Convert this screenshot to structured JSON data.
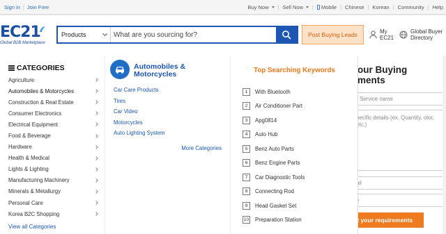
{
  "topbar": {
    "sign_in": "Sign in",
    "join_free": "Join Free",
    "links": [
      {
        "label": "Buy Now",
        "dropdown": true
      },
      {
        "label": "Sell Now",
        "dropdown": true
      },
      {
        "label": "Mobile",
        "icon": "mobile-icon"
      },
      {
        "label": "Chinese"
      },
      {
        "label": "Korean"
      },
      {
        "label": "Community"
      },
      {
        "label": "Help"
      }
    ]
  },
  "header": {
    "logo_text": "EC21",
    "logo_tagline": "Global B2B Marketplace",
    "search": {
      "category": "Products",
      "placeholder": "What are you sourcing for?"
    },
    "post_buying_leads": "Post Buying Leads",
    "my_ec21_line1": "My",
    "my_ec21_line2": "EC21",
    "global_dir_line1": "Global Buyer",
    "global_dir_line2": "Directory"
  },
  "categories": {
    "title": "CATEGORIES",
    "items": [
      "Agriculture",
      "Automobiles & Motorcycles",
      "Construction & Real Estate",
      "Consumer Electronics",
      "Electrical Equipment",
      "Food & Beverage",
      "Hardware",
      "Health & Medical",
      "Lights & Lighting",
      "Manufacturing Machinery",
      "Minerals & Metallurgy",
      "Personal Care",
      "Korea B2C Shopping"
    ],
    "active_index": 1,
    "view_all": "View all Categories"
  },
  "subcategory": {
    "title_line1": "Automobiles &",
    "title_line2": "Motorcycles",
    "icon": "car-icon",
    "items": [
      "Car Care Products",
      "Tires",
      "Car Video",
      "Motorcycles",
      "Auto Lighting System"
    ],
    "more": "More Categories"
  },
  "keywords": {
    "title": "Top Searching Keywords",
    "items": [
      {
        "rank": "1",
        "label": "With Bluetooth"
      },
      {
        "rank": "2",
        "label": "Air Conditioner Part"
      },
      {
        "rank": "3",
        "label": "Apg0814"
      },
      {
        "rank": "4",
        "label": "Auto Hub"
      },
      {
        "rank": "5",
        "label": "Benz Auto Parts"
      },
      {
        "rank": "6",
        "label": "Benz Engine Parts"
      },
      {
        "rank": "7",
        "label": "Car Diagnostic Tools"
      },
      {
        "rank": "8",
        "label": "Connecting Rod"
      },
      {
        "rank": "9",
        "label": "Head Gasket Set"
      },
      {
        "rank": "10",
        "label": "Preparation Station"
      }
    ]
  },
  "buying_request": {
    "title_line1": "our Buying",
    "title_line2": "ments",
    "service_name_placeholder": "* Service name",
    "details_placeholder": "pecific details (ex. Quantity, olor, etc.)",
    "email_placeholder": "ail",
    "phone_placeholder": "e",
    "submit": "it your requirements"
  },
  "colors": {
    "brand_blue": "#1e56b3",
    "link_blue": "#1a56b0",
    "accent_orange": "#ee7b20",
    "keyword_orange": "#e8791d"
  }
}
